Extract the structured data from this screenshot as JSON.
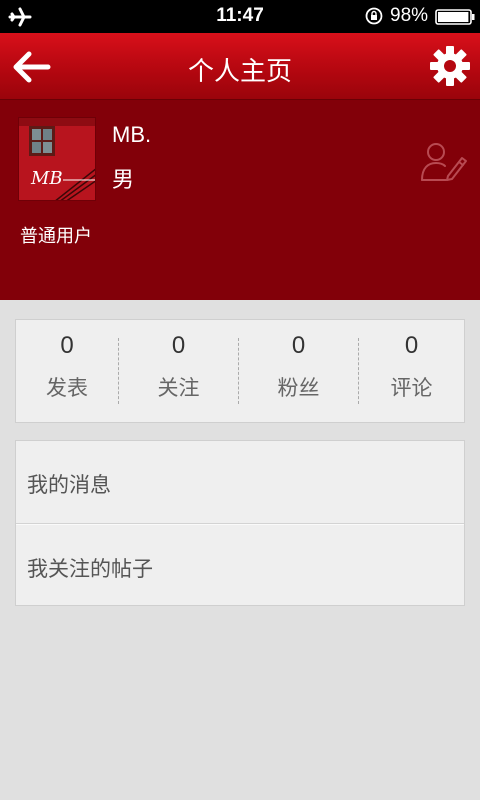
{
  "status_bar": {
    "time": "11:47",
    "battery_percent": "98%",
    "battery_level": 0.98,
    "icons": [
      "airplane-icon",
      "rotation-lock-icon",
      "battery-icon"
    ]
  },
  "header": {
    "title": "个人主页",
    "back_icon": "back-arrow-icon",
    "settings_icon": "gear-icon"
  },
  "profile": {
    "avatar_initials": "MB",
    "username": "MB.",
    "gender": "男",
    "user_level": "普通用户",
    "edit_icon": "edit-profile-icon"
  },
  "stats": [
    {
      "value": "0",
      "label": "发表"
    },
    {
      "value": "0",
      "label": "关注"
    },
    {
      "value": "0",
      "label": "粉丝"
    },
    {
      "value": "0",
      "label": "评论"
    }
  ],
  "menu": [
    {
      "label": "我的消息"
    },
    {
      "label": "我关注的帖子"
    }
  ],
  "colors": {
    "header_red": "#b50710",
    "profile_bg": "#820009",
    "page_bg": "#e0e0e0",
    "card_bg": "#efefef"
  }
}
